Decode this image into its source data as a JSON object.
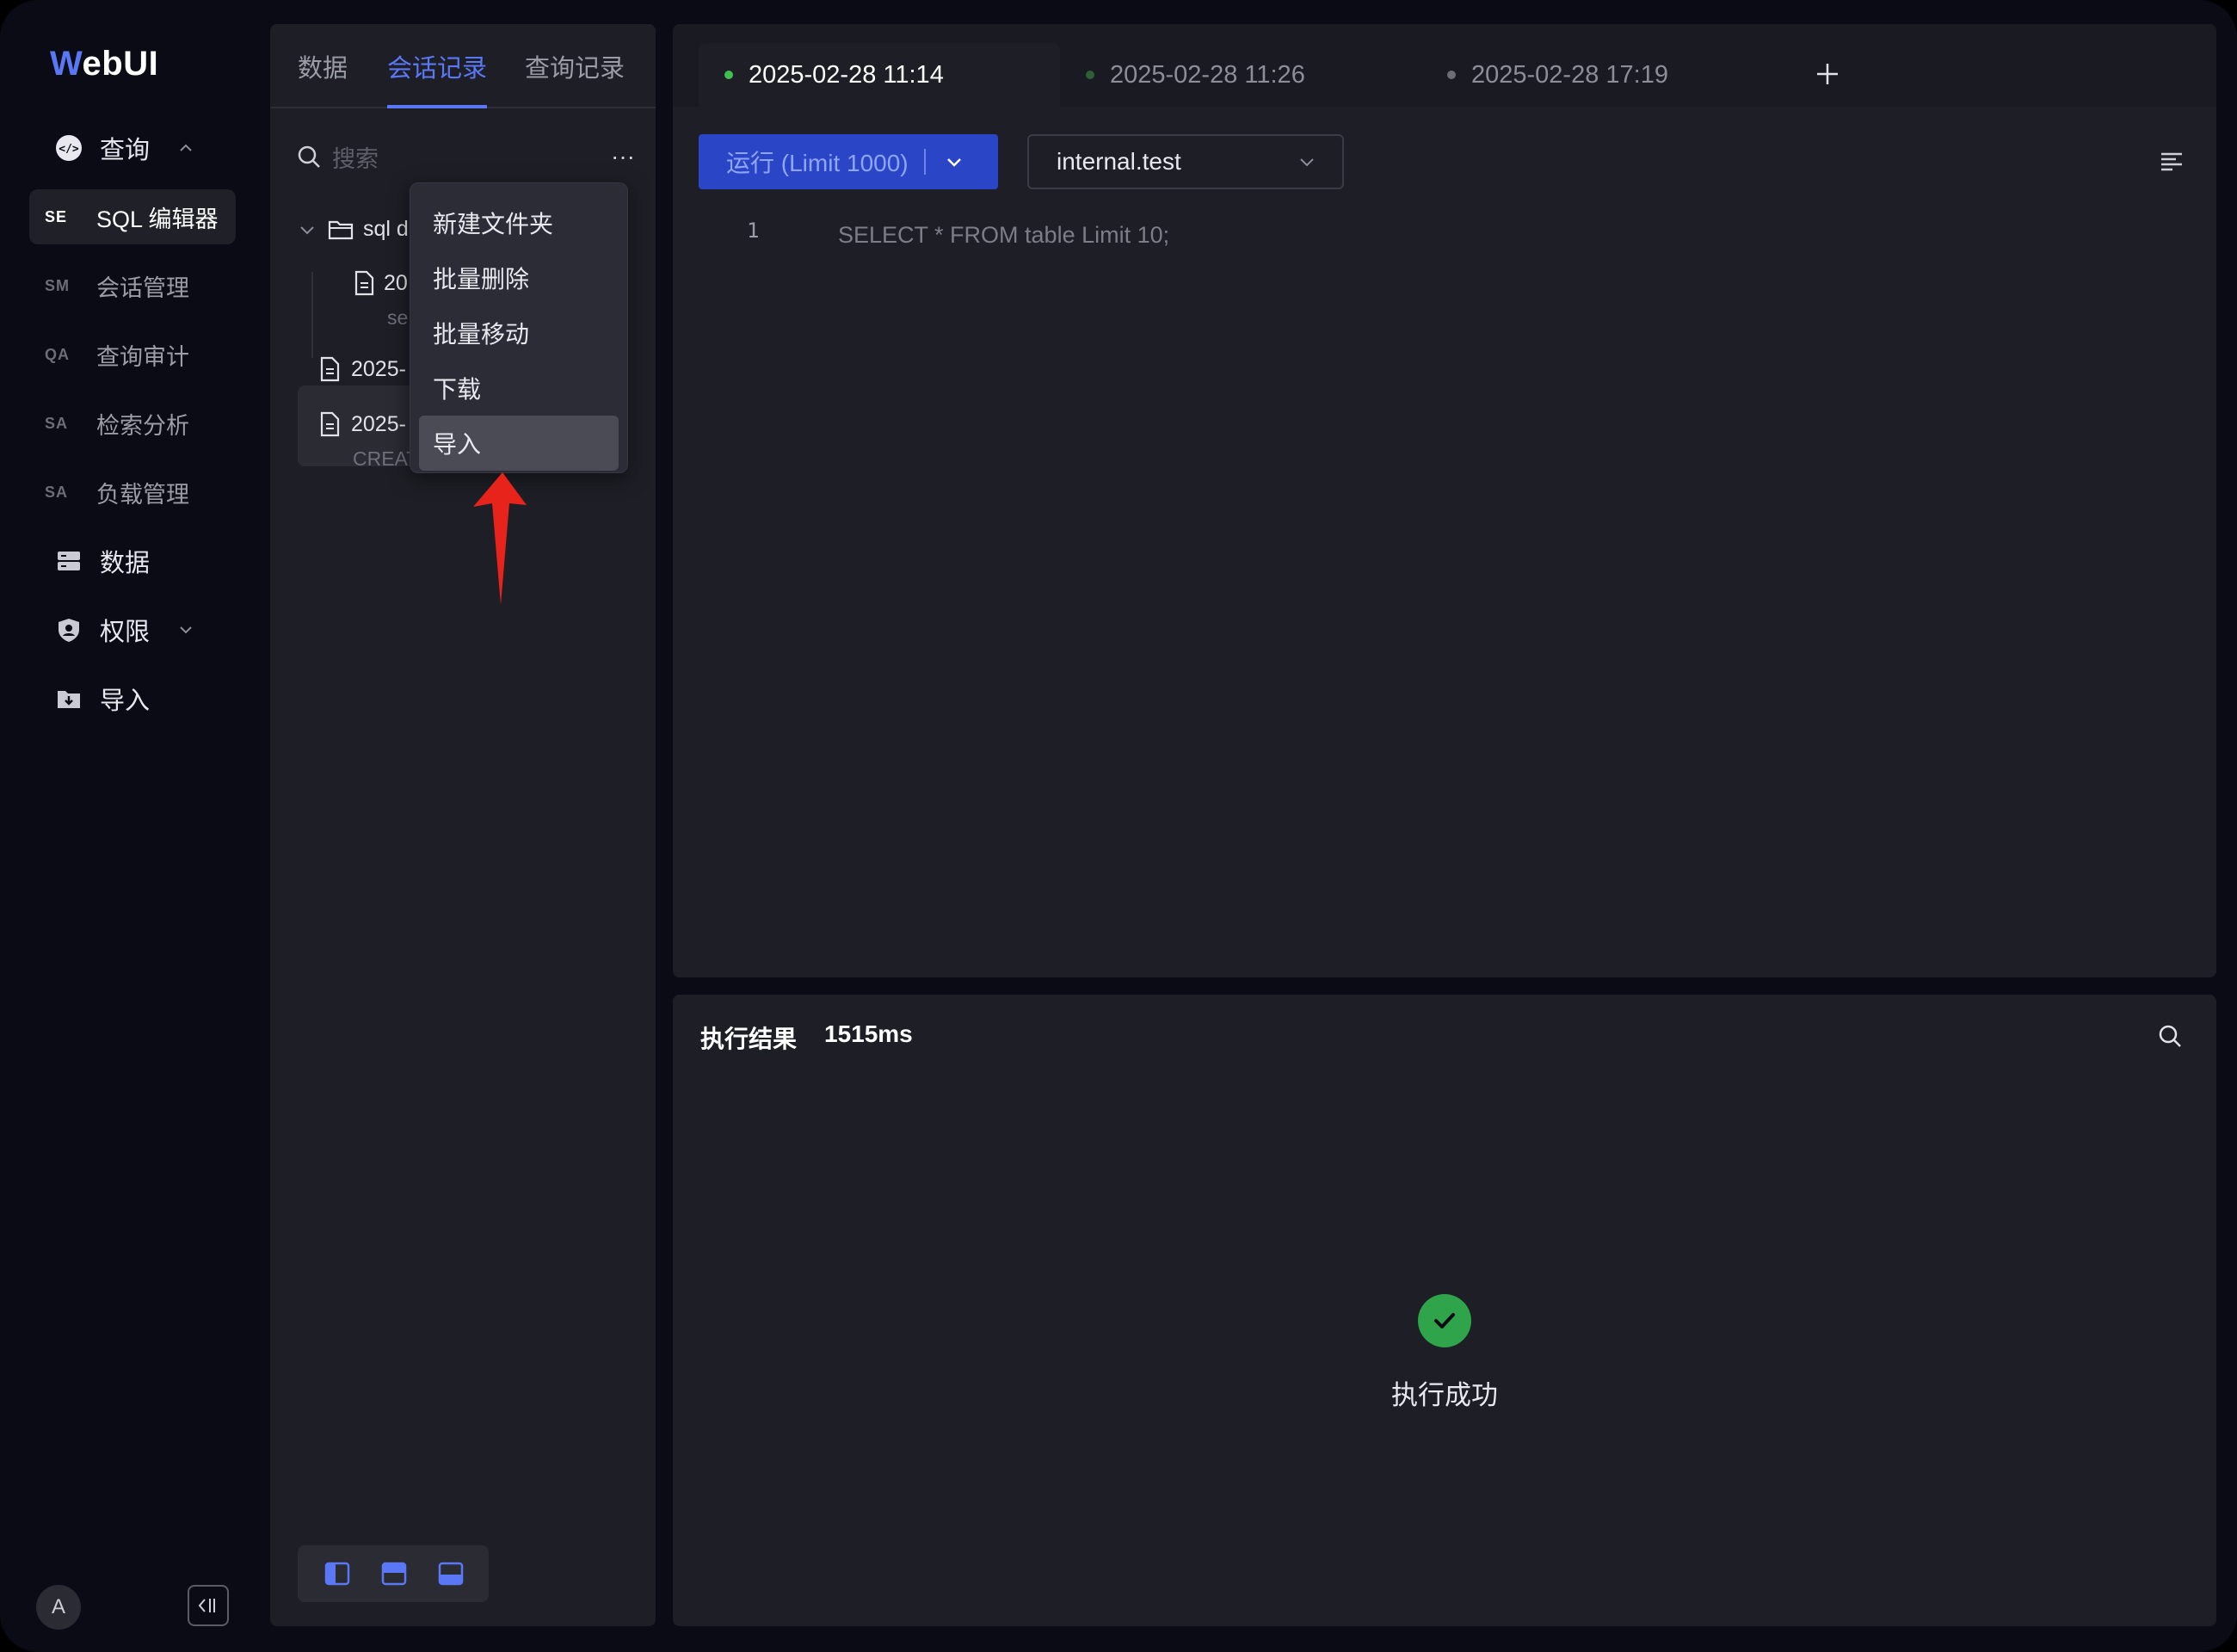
{
  "app": {
    "logo_first": "W",
    "logo_rest": "ebUI"
  },
  "nav": {
    "query": {
      "label": "查询"
    },
    "sub_items": [
      {
        "abbr": "SE",
        "label": "SQL 编辑器"
      },
      {
        "abbr": "SM",
        "label": "会话管理"
      },
      {
        "abbr": "QA",
        "label": "查询审计"
      },
      {
        "abbr": "SA",
        "label": "检索分析"
      },
      {
        "abbr": "SA",
        "label": "负载管理"
      }
    ],
    "data": {
      "label": "数据"
    },
    "permissions": {
      "label": "权限"
    },
    "import": {
      "label": "导入"
    },
    "avatar_letter": "A"
  },
  "panel": {
    "tabs": [
      {
        "label": "数据"
      },
      {
        "label": "会话记录"
      },
      {
        "label": "查询记录"
      }
    ],
    "search_placeholder": "搜索",
    "more_label": "···",
    "tree": {
      "folder": "sql d",
      "child_file": "20",
      "child_sub": "se",
      "file_2": "2025-",
      "file_3": "2025-",
      "file_3_sub": "CREAT"
    },
    "context_menu": [
      {
        "label": "新建文件夹"
      },
      {
        "label": "批量删除"
      },
      {
        "label": "批量移动"
      },
      {
        "label": "下载"
      },
      {
        "label": "导入"
      }
    ]
  },
  "editor": {
    "tabs": [
      {
        "label": "2025-02-28 11:14",
        "dot_color": "#3fbf50"
      },
      {
        "label": "2025-02-28 11:26",
        "dot_color": "#2f5f36"
      },
      {
        "label": "2025-02-28 17:19",
        "dot_color": "#6b6d78"
      }
    ],
    "run_label": "运行 (Limit 1000)",
    "database": "internal.test",
    "line_number": "1",
    "code": "SELECT * FROM table Limit 10;"
  },
  "results": {
    "title": "执行结果",
    "duration": "1515ms",
    "status": "执行成功"
  },
  "colors": {
    "accent": "#5a78f6",
    "run_button": "#2b45c7",
    "success": "#2fa44a",
    "annotation_arrow": "#e8231b"
  }
}
